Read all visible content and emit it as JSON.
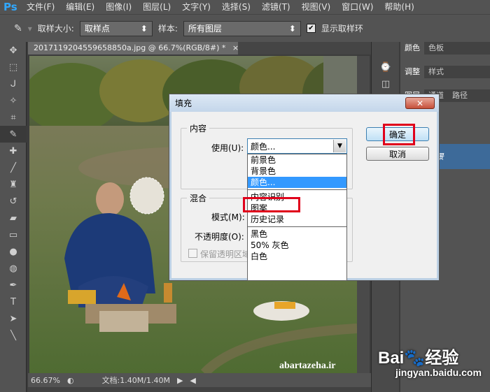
{
  "app": {
    "logo": "Ps"
  },
  "menu": [
    "文件(F)",
    "编辑(E)",
    "图像(I)",
    "图层(L)",
    "文字(Y)",
    "选择(S)",
    "滤镜(T)",
    "视图(V)",
    "窗口(W)",
    "帮助(H)"
  ],
  "options": {
    "sample_size_label": "取样大小:",
    "sample_size_value": "取样点",
    "sample_label": "样本:",
    "sample_value": "所有图层",
    "show_ring_label": "显示取样环"
  },
  "document": {
    "tab_title": "2017119204559658850a.jpg @ 66.7%(RGB/8#) *",
    "zoom": "66.67%",
    "doc_info": "文档:1.40M/1.40M",
    "image_watermark": "abartazeha.ir"
  },
  "panels": {
    "tabs_row1": [
      "颜色",
      "色板"
    ],
    "tabs_row2": [
      "调整",
      "样式"
    ],
    "tabs_row3": [
      "图层",
      "通道",
      "路径"
    ],
    "layer_name": "背景"
  },
  "dialog": {
    "title": "填充",
    "content_group": "内容",
    "use_label": "使用(U):",
    "use_value": "颜色...",
    "blend_group": "混合",
    "mode_label": "模式(M):",
    "opacity_label": "不透明度(O):",
    "preserve_label": "保留透明区域",
    "ok_label": "确定",
    "cancel_label": "取消",
    "dropdown_items": [
      "前景色",
      "背景色",
      "颜色...",
      "内容识别",
      "图案",
      "历史记录",
      "黑色",
      "50% 灰色",
      "白色"
    ],
    "selected_item": "颜色..."
  },
  "watermark": {
    "brand": "Bai",
    "brand_suffix": "经验",
    "url": "jingyan.baidu.com"
  }
}
